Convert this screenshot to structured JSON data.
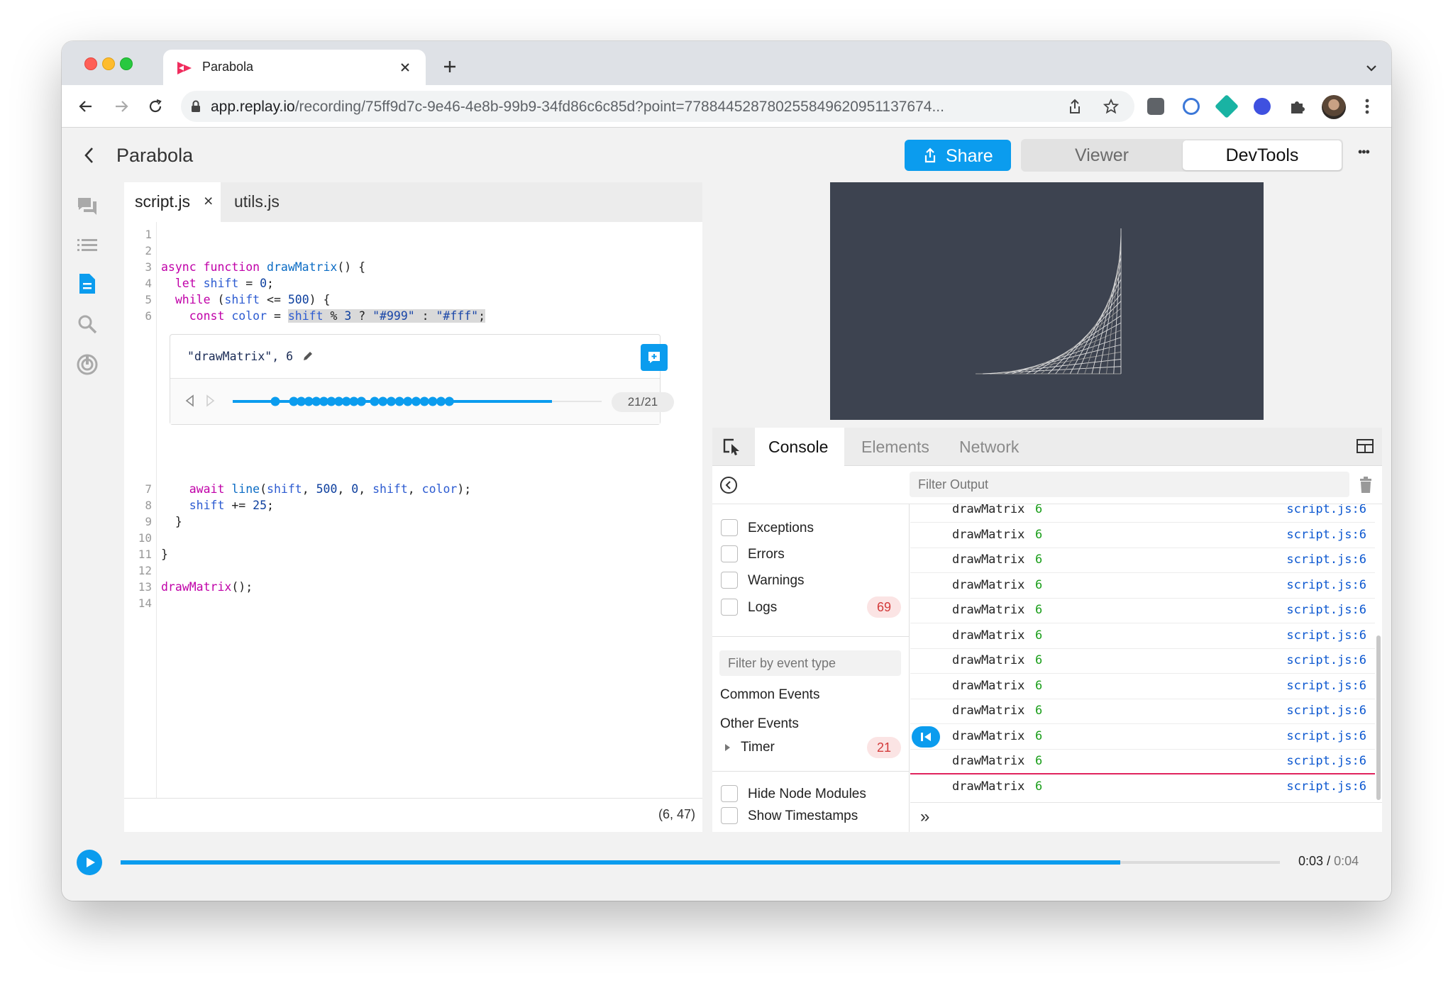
{
  "browser": {
    "tab_title": "Parabola",
    "url_host": "app.replay.io",
    "url_path": "/recording/75ff9d7c-9e46-4e8b-99b9-34fd86c6c85d?point=778844528780255849620951137674..."
  },
  "header": {
    "back_glyph": "‹",
    "title": "Parabola",
    "share_label": "Share",
    "viewer_label": "Viewer",
    "devtools_label": "DevTools",
    "more_glyph": "•••"
  },
  "editor": {
    "tabs": [
      {
        "label": "script.js",
        "close": "×",
        "active": true
      },
      {
        "label": "utils.js",
        "active": false
      }
    ],
    "line_numbers_top": [
      "1",
      "2",
      "3",
      "4",
      "5",
      "6"
    ],
    "line_numbers_bottom": [
      "7",
      "8",
      "9",
      "10",
      "11",
      "12",
      "13",
      "14"
    ],
    "lines": {
      "l3": {
        "kw": "async function",
        "fn": "drawMatrix",
        "rest": "() {"
      },
      "l4": {
        "kw": "let",
        "var": "shift",
        "rest": " = ",
        "num": "0",
        "end": ";"
      },
      "l5": {
        "kw": "while",
        "open": " (",
        "var": "shift",
        "rest": " <= ",
        "num": "500",
        "end": ") {"
      },
      "l6": {
        "kw": "const",
        "var": "color",
        "eq": " = ",
        "sel_var": "shift",
        "sel_op": " % ",
        "sel_num": "3",
        "sel_q": " ? ",
        "sel_s1": "\"#999\"",
        "sel_c": " : ",
        "sel_s2": "\"#fff\"",
        "sel_end": ";"
      },
      "l7": {
        "kw": "await",
        "fn": "line",
        "p1": "(",
        "a1": "shift",
        "c1": ", ",
        "a2": "500",
        "c2": ", ",
        "a3": "0",
        "c3": ", ",
        "a4": "shift",
        "c4": ", ",
        "a5": "color",
        "p2": ");"
      },
      "l8": {
        "var": "shift",
        "rest": " += ",
        "num": "25",
        "end": ";"
      },
      "l9": "}",
      "l11": "}",
      "l13": {
        "fn": "drawMatrix",
        "rest": "();"
      }
    },
    "log_panel": {
      "expression": "\"drawMatrix\", 6",
      "counter": "21/21",
      "hit_count": 21
    },
    "cursor_position": "(6, 47)"
  },
  "devtools": {
    "tabs": [
      "Console",
      "Elements",
      "Network"
    ],
    "active_tab": "Console",
    "filter_placeholder": "Filter Output",
    "filters": [
      {
        "label": "Exceptions",
        "checked": false
      },
      {
        "label": "Errors",
        "checked": false
      },
      {
        "label": "Warnings",
        "checked": false
      },
      {
        "label": "Logs",
        "checked": false,
        "count": "69"
      }
    ],
    "event_filter_placeholder": "Filter by event type",
    "common_events_label": "Common Events",
    "other_events_label": "Other Events",
    "timer_label": "Timer",
    "timer_count": "21",
    "hide_node_modules_label": "Hide Node Modules",
    "show_timestamps_label": "Show Timestamps",
    "log_rows": [
      {
        "text": "drawMatrix",
        "value": "6",
        "source": "script.js:6"
      },
      {
        "text": "drawMatrix",
        "value": "6",
        "source": "script.js:6"
      },
      {
        "text": "drawMatrix",
        "value": "6",
        "source": "script.js:6"
      },
      {
        "text": "drawMatrix",
        "value": "6",
        "source": "script.js:6"
      },
      {
        "text": "drawMatrix",
        "value": "6",
        "source": "script.js:6"
      },
      {
        "text": "drawMatrix",
        "value": "6",
        "source": "script.js:6"
      },
      {
        "text": "drawMatrix",
        "value": "6",
        "source": "script.js:6"
      },
      {
        "text": "drawMatrix",
        "value": "6",
        "source": "script.js:6"
      },
      {
        "text": "drawMatrix",
        "value": "6",
        "source": "script.js:6"
      },
      {
        "text": "drawMatrix",
        "value": "6",
        "source": "script.js:6"
      },
      {
        "text": "drawMatrix",
        "value": "6",
        "source": "script.js:6"
      },
      {
        "text": "drawMatrix",
        "value": "6",
        "source": "script.js:6"
      }
    ],
    "prompt_glyph": "»"
  },
  "timeline": {
    "current_time": "0:03",
    "separator": "/",
    "total_time": "0:04",
    "progress_fraction": 0.862
  },
  "colors": {
    "accent": "#0b9cee",
    "canvas_bg": "#3d4350",
    "highlight_line": "#e0245e",
    "count_badge_text": "#d33a3a",
    "count_badge_bg": "#fbe4e4",
    "console_value": "#1a9e1a",
    "source_link": "#0b57d0"
  }
}
